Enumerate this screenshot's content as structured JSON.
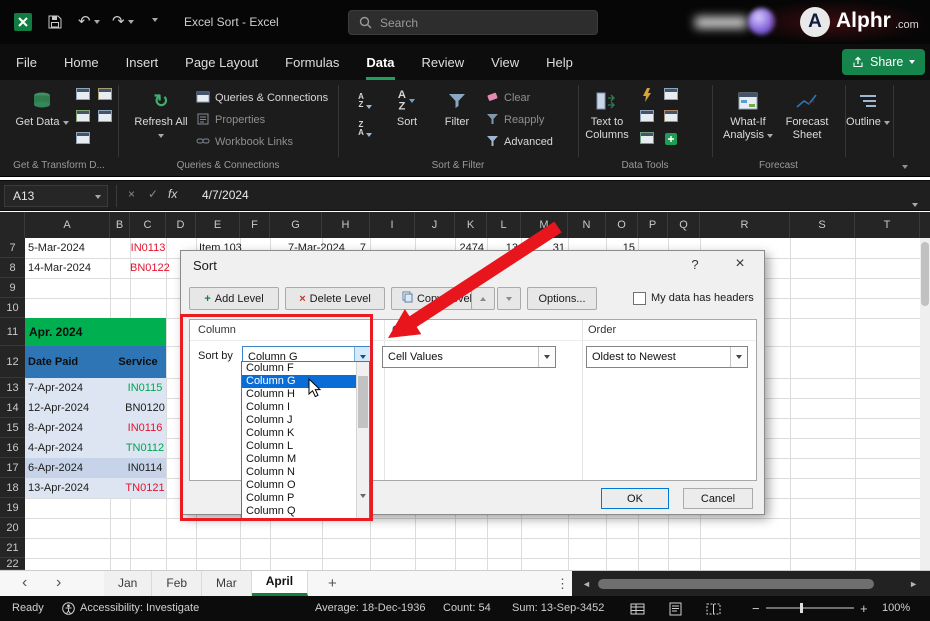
{
  "colors": {
    "excel_green": "#107c41",
    "share_green": "#15854b",
    "banner_green": "#00b050",
    "header_blue": "#2e75b6",
    "selection_blue": "#0a6cd6",
    "annotation_red": "#e8151d",
    "cell_red": "#e8112d",
    "cell_green": "#00a651"
  },
  "titlebar": {
    "title": "Excel Sort - Excel",
    "search_placeholder": "Search",
    "undo_glyph": "↶",
    "redo_glyph": "↷",
    "brand_initial": "A",
    "brand": "Alphr",
    "brand_tld": ".com"
  },
  "menubar": {
    "items": [
      "File",
      "Home",
      "Insert",
      "Page Layout",
      "Formulas",
      "Data",
      "Review",
      "View",
      "Help"
    ],
    "active_item": "Data",
    "share_label": "Share"
  },
  "ribbon": {
    "get_data": "Get Data",
    "refresh_all": "Refresh All",
    "refresh_glyph": "↻",
    "queries_connections": "Queries & Connections",
    "properties": "Properties",
    "workbook_links": "Workbook Links",
    "sort_a": "A",
    "sort_z": "Z",
    "sort_label": "Sort",
    "filter_label": "Filter",
    "clear_label": "Clear",
    "reapply_label": "Reapply",
    "advanced_label": "Advanced",
    "text_to_columns": "Text to Columns",
    "what_if_analysis": "What-If Analysis",
    "forecast_sheet": "Forecast Sheet",
    "outline_label": "Outline",
    "groups": [
      "Get & Transform D...",
      "Queries & Connections",
      "Sort & Filter",
      "Data Tools",
      "Forecast"
    ]
  },
  "formula_bar": {
    "name_box": "A13",
    "cancel_glyph": "×",
    "enter_glyph": "✓",
    "fx_label": "fx",
    "value": "4/7/2024"
  },
  "grid": {
    "columns": [
      "A",
      "B",
      "C",
      "D",
      "E",
      "F",
      "G",
      "H",
      "I",
      "J",
      "K",
      "L",
      "M",
      "N",
      "O",
      "P",
      "Q",
      "R",
      "S",
      "T"
    ],
    "rows": [
      "7",
      "8",
      "9",
      "10",
      "11",
      "12",
      "13",
      "14",
      "15",
      "16",
      "17",
      "18",
      "19",
      "20",
      "21",
      "22"
    ],
    "cells_row7": {
      "a": "5-Mar-2024",
      "c": "IN0113",
      "e": "Item 103",
      "g": "7-Mar-2024",
      "h": "7",
      "k": "2474",
      "l": "13",
      "m": "31",
      "o": "15"
    },
    "cells_row8": {
      "a": "14-Mar-2024",
      "c": "BN0122"
    },
    "banner_label": "Apr. 2024",
    "table_headers": {
      "date": "Date Paid",
      "service": "Service"
    },
    "table_rows": [
      {
        "date": "7-Apr-2024",
        "service": "IN0115",
        "service_color": "#00a651"
      },
      {
        "date": "12-Apr-2024",
        "service": "BN0120",
        "service_color": "#202020"
      },
      {
        "date": "8-Apr-2024",
        "service": "IN0116",
        "service_color": "#e8112d"
      },
      {
        "date": "4-Apr-2024",
        "service": "TN0112",
        "service_color": "#00a651"
      },
      {
        "date": "6-Apr-2024",
        "service": "IN0114",
        "service_color": "#202020"
      },
      {
        "date": "13-Apr-2024",
        "service": "TN0121",
        "service_color": "#e8112d"
      }
    ]
  },
  "sort_dialog": {
    "title": "Sort",
    "help_glyph": "?",
    "close_glyph": "×",
    "add_glyph": "+",
    "delete_glyph": "×",
    "add_level": "Add Level",
    "delete_level": "Delete Level",
    "copy_level": "Copy Level",
    "options_label": "Options...",
    "my_data_has_headers": "My data has headers",
    "column_header": "Column",
    "on_header": "On",
    "order_header": "Order",
    "sort_by_label": "Sort by",
    "sort_by_value": "Column G",
    "on_value": "Cell Values",
    "order_value": "Oldest to Newest",
    "column_options": [
      "Column F",
      "Column G",
      "Column H",
      "Column I",
      "Column J",
      "Column K",
      "Column L",
      "Column M",
      "Column N",
      "Column O",
      "Column P",
      "Column Q"
    ],
    "selected_option": "Column G",
    "ok_label": "OK",
    "cancel_label": "Cancel"
  },
  "sheet_tabs": {
    "prev_glyph": "‹",
    "next_glyph": "›",
    "tabs": [
      "Jan",
      "Feb",
      "Mar",
      "April"
    ],
    "active_tab": "April",
    "add_glyph": "+",
    "more_glyph": "⋮",
    "scroll_left_glyph": "◄",
    "scroll_right_glyph": "►"
  },
  "status_bar": {
    "mode": "Ready",
    "accessibility": "Accessibility: Investigate",
    "average": "Average: 18-Dec-1936",
    "count": "Count: 54",
    "sum": "Sum: 13-Sep-3452",
    "zoom_out_glyph": "−",
    "zoom_in_glyph": "+",
    "zoom_level": "100%"
  }
}
